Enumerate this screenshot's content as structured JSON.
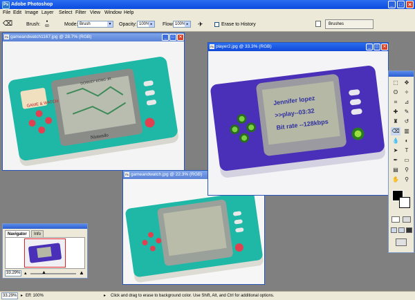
{
  "app": {
    "title": "Adobe Photoshop",
    "icon": "photoshop-icon",
    "icon_glyph": "Ps"
  },
  "window_controls": {
    "minimize": "_",
    "maximize": "□",
    "close": "✕"
  },
  "menu": [
    "File",
    "Edit",
    "Image",
    "Layer",
    "Select",
    "Filter",
    "View",
    "Window",
    "Help"
  ],
  "options": {
    "brush_label": "Brush:",
    "brush_size": "60",
    "mode_label": "Mode:",
    "mode_value": "Brush",
    "opacity_label": "Opacity:",
    "opacity_value": "100%",
    "flow_label": "Flow:",
    "flow_value": "100%",
    "erase_history_label": "Erase to History",
    "brushes_tab": "Brushes",
    "dropdown_glyph": "▼"
  },
  "documents": [
    {
      "title": "gameandwatch1167.jpg @ 28.7% (RGB)",
      "active": false
    },
    {
      "title": "player2.jpg @ 33.3% (RGB)",
      "active": true
    },
    {
      "title": "gameandwatch.jpg @ 22.3% (RGB)",
      "active": false
    }
  ],
  "player_screen": {
    "line1": "Jennifer lopez",
    "line2": ">>play--03:32",
    "line3": "Bit rate --128kbps"
  },
  "gw1_brand_top": "GAME & WATCH",
  "gw1_screen_title": "DONKEY KONG JR.",
  "gw1_brand": "Nintendo",
  "navigator": {
    "tab_navigator": "Navigator",
    "tab_info": "Info",
    "zoom": "33.29%"
  },
  "status": {
    "zoom": "33.29%",
    "eff": "Eff: 100%",
    "message": "Click and drag to erase to background color.  Use Shift, Alt, and Ctrl for additional options."
  },
  "colors": {
    "titlebar": "#0a4be0",
    "chrome": "#ece9d8",
    "workspace": "#808080",
    "teal": "#1fb8a6",
    "purple": "#4a2fb8",
    "lcd": "#b8bca8"
  }
}
